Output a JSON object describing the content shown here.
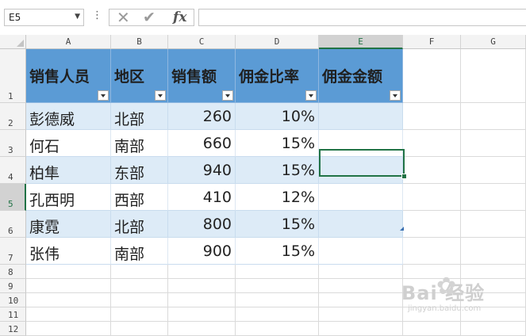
{
  "formula_bar": {
    "name_box": "E5",
    "dots": "⋮",
    "cancel": "✕",
    "enter": "✔",
    "fx": "fx",
    "formula": ""
  },
  "columns": [
    "A",
    "B",
    "C",
    "D",
    "E",
    "F",
    "G"
  ],
  "selected_column": "E",
  "rows": [
    "1",
    "2",
    "3",
    "4",
    "5",
    "6",
    "7",
    "8",
    "9",
    "10",
    "11",
    "12"
  ],
  "selected_row": "5",
  "table": {
    "headers": [
      "销售人员",
      "地区",
      "销售额",
      "佣金比率",
      "佣金金额"
    ],
    "rows": [
      [
        "彭德威",
        "北部",
        "260",
        "10%",
        ""
      ],
      [
        "何石",
        "南部",
        "660",
        "15%",
        ""
      ],
      [
        "柏隼",
        "东部",
        "940",
        "15%",
        ""
      ],
      [
        "孔西明",
        "西部",
        "410",
        "12%",
        ""
      ],
      [
        "康霓",
        "北部",
        "800",
        "15%",
        ""
      ],
      [
        "张伟",
        "南部",
        "900",
        "15%",
        ""
      ]
    ]
  },
  "watermark": {
    "brand": "Bai 经验",
    "site": "jingyan.baidu.com"
  },
  "colors": {
    "header_fill": "#5b9bd5",
    "band_fill": "#ddebf7",
    "selection": "#217346"
  }
}
